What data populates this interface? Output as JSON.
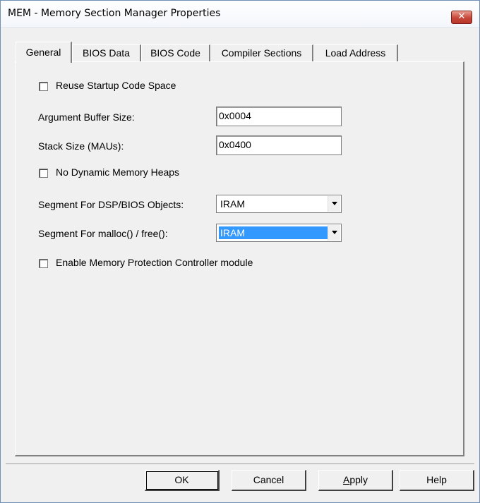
{
  "window": {
    "title": "MEM - Memory Section Manager Properties",
    "close_glyph": "✕"
  },
  "tabs": [
    "General",
    "BIOS Data",
    "BIOS Code",
    "Compiler Sections",
    "Load Address"
  ],
  "general": {
    "reuse_startup": {
      "label": "Reuse Startup Code Space",
      "checked": false
    },
    "arg_buffer": {
      "label": "Argument Buffer Size:",
      "value": "0x0004"
    },
    "stack_size": {
      "label": "Stack Size (MAUs):",
      "value": "0x0400"
    },
    "no_dynamic_heaps": {
      "label": "No Dynamic Memory Heaps",
      "checked": false
    },
    "segment_bios": {
      "label": "Segment For DSP/BIOS Objects:",
      "value": "IRAM"
    },
    "segment_malloc": {
      "label": "Segment For malloc() / free():",
      "value": "IRAM"
    },
    "enable_mpc": {
      "label": "Enable Memory Protection Controller module",
      "checked": false
    }
  },
  "buttons": {
    "ok": "OK",
    "cancel": "Cancel",
    "apply_first": "A",
    "apply_rest": "pply",
    "help": "Help"
  },
  "colors": {
    "selection": "#3399ff",
    "close_red": "#c7473a",
    "dialog_bg": "#f0f0f0"
  }
}
